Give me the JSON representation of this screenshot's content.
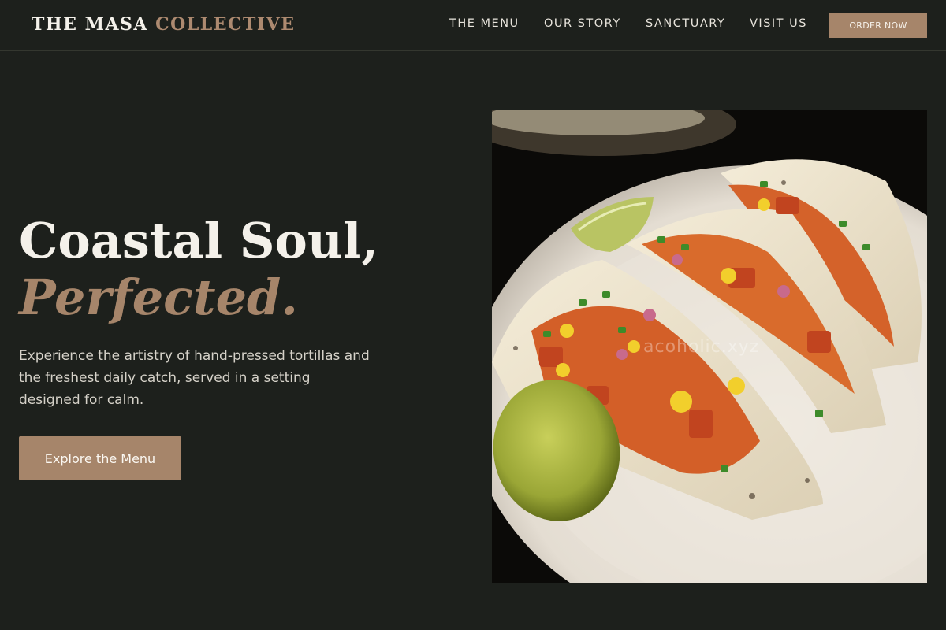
{
  "brand": {
    "name_primary": "THE MASA",
    "name_secondary": "COLLECTIVE"
  },
  "nav": {
    "items": [
      {
        "label": "THE MENU"
      },
      {
        "label": "OUR STORY"
      },
      {
        "label": "SANCTUARY"
      },
      {
        "label": "VISIT US"
      }
    ],
    "order_label": "ORDER NOW"
  },
  "hero": {
    "title_line1": "Coastal Soul,",
    "title_line2": "Perfected.",
    "description": "Experience the artistry of hand-pressed tortillas and the freshest daily catch, served in a setting designed for calm.",
    "cta_label": "Explore the Menu"
  },
  "image": {
    "subject": "tacos-with-lime-on-plate",
    "watermark": "acoholic.xyz"
  },
  "colors": {
    "background": "#1d201c",
    "accent": "#a6856a",
    "text_light": "#f4f1ea",
    "text_muted": "#d6d2c9"
  }
}
